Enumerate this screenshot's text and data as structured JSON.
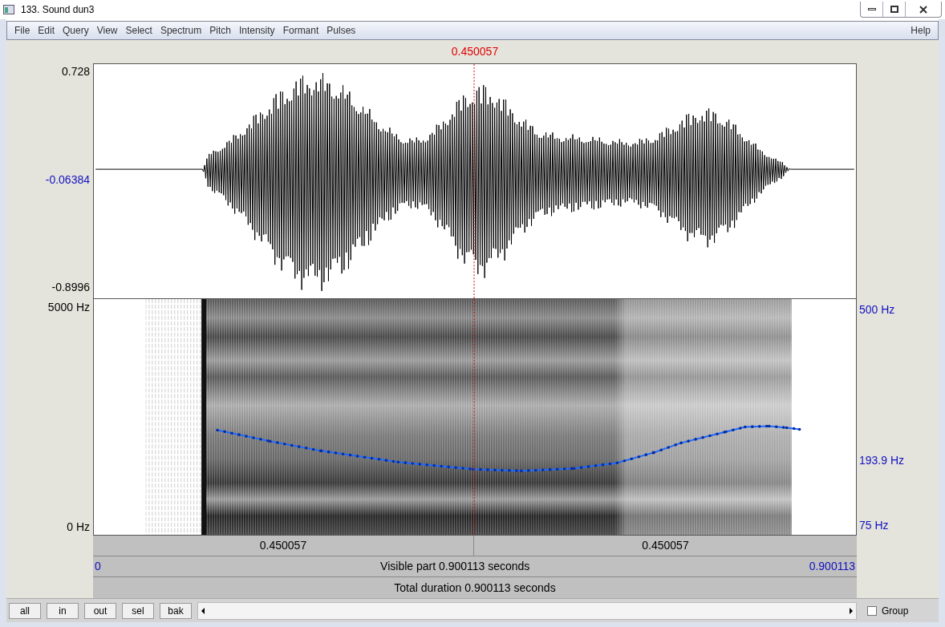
{
  "window": {
    "title": "133. Sound dun3"
  },
  "menu": [
    {
      "label": "File"
    },
    {
      "label": "Edit"
    },
    {
      "label": "Query"
    },
    {
      "label": "View"
    },
    {
      "label": "Select"
    },
    {
      "label": "Spectrum"
    },
    {
      "label": "Pitch"
    },
    {
      "label": "Intensity"
    },
    {
      "label": "Formant"
    },
    {
      "label": "Pulses"
    }
  ],
  "help": "Help",
  "cursor_time": "0.450057",
  "waveform": {
    "y_max": "0.728",
    "y_zero": "-0.06384",
    "y_min": "-0.8996"
  },
  "spectrogram": {
    "y_max": "5000 Hz",
    "y_min": "0 Hz"
  },
  "pitch": {
    "y_max": "500 Hz",
    "y_cursor": "193.9 Hz",
    "y_min": "75 Hz"
  },
  "time_rows": {
    "left_half": "0.450057",
    "right_half": "0.450057",
    "visible_start": "0",
    "visible_label": "Visible part 0.900113 seconds",
    "visible_end": "0.900113",
    "total": "Total duration 0.900113 seconds"
  },
  "buttons": [
    "all",
    "in",
    "out",
    "sel",
    "bak"
  ],
  "group": {
    "label": "Group",
    "checked": false
  }
}
